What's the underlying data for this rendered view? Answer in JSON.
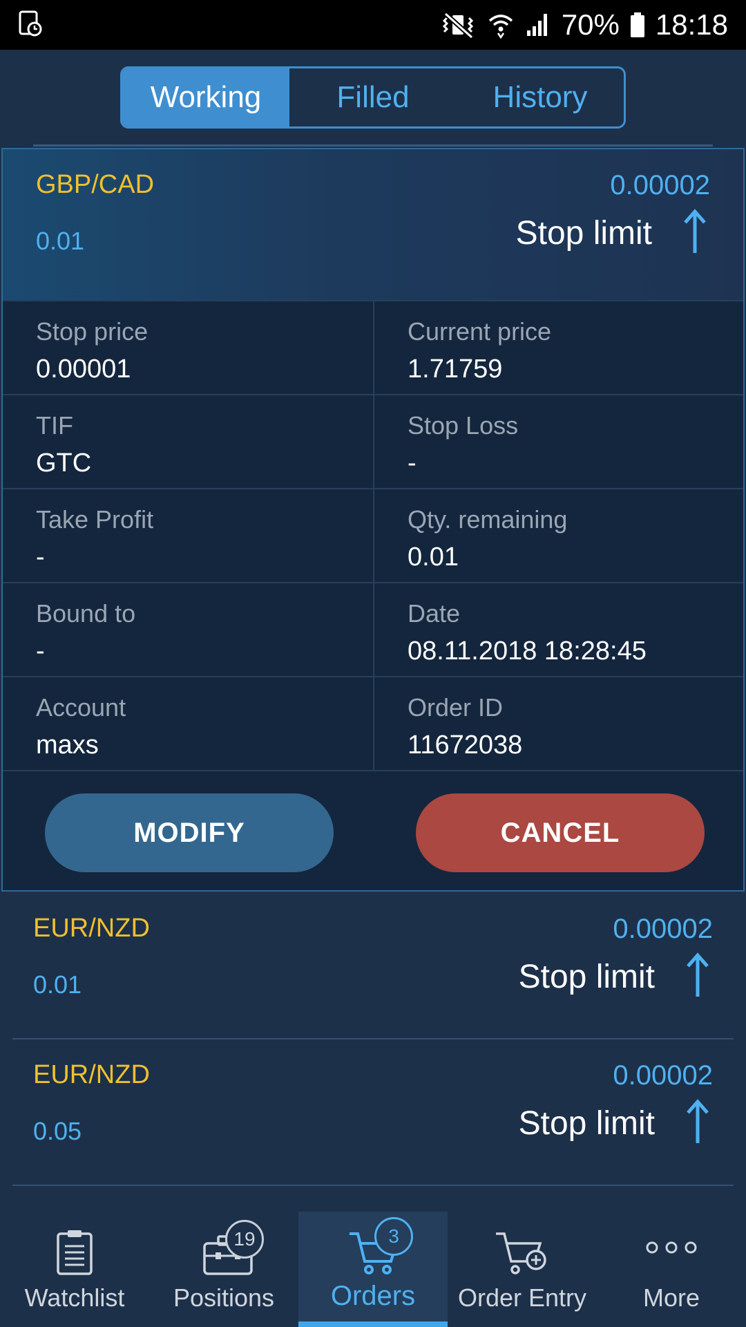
{
  "status_bar": {
    "battery": "70%",
    "time": "18:18",
    "icons": [
      "screenshot-icon",
      "mute-vibrate-icon",
      "wifi-icon",
      "signal-icon",
      "battery-icon"
    ]
  },
  "tabs": [
    {
      "label": "Working",
      "active": true
    },
    {
      "label": "Filled",
      "active": false
    },
    {
      "label": "History",
      "active": false
    }
  ],
  "expanded_order": {
    "symbol": "GBP/CAD",
    "quantity": "0.01",
    "price": "0.00002",
    "order_type": "Stop limit",
    "direction_icon": "arrow-up-icon",
    "fields": [
      {
        "label": "Stop price",
        "value": "0.00001"
      },
      {
        "label": "Current price",
        "value": "1.71759"
      },
      {
        "label": "TIF",
        "value": "GTC"
      },
      {
        "label": "Stop Loss",
        "value": "-"
      },
      {
        "label": "Take Profit",
        "value": "-"
      },
      {
        "label": "Qty. remaining",
        "value": "0.01"
      },
      {
        "label": "Bound to",
        "value": "-"
      },
      {
        "label": "Date",
        "value": "08.11.2018 18:28:45"
      },
      {
        "label": "Account",
        "value": "maxs"
      },
      {
        "label": "Order ID",
        "value": "11672038"
      }
    ],
    "modify_label": "MODIFY",
    "cancel_label": "CANCEL"
  },
  "orders": [
    {
      "symbol": "EUR/NZD",
      "quantity": "0.01",
      "price": "0.00002",
      "order_type": "Stop limit"
    },
    {
      "symbol": "EUR/NZD",
      "quantity": "0.05",
      "price": "0.00002",
      "order_type": "Stop limit"
    }
  ],
  "bottom_nav": [
    {
      "label": "Watchlist",
      "icon": "clipboard-list-icon",
      "badge": null,
      "active": false
    },
    {
      "label": "Positions",
      "icon": "briefcase-icon",
      "badge": "19",
      "active": false
    },
    {
      "label": "Orders",
      "icon": "cart-icon",
      "badge": "3",
      "active": true
    },
    {
      "label": "Order Entry",
      "icon": "cart-plus-icon",
      "badge": null,
      "active": false
    },
    {
      "label": "More",
      "icon": "more-dots-icon",
      "badge": null,
      "active": false
    }
  ],
  "colors": {
    "background": "#1d3049",
    "accent": "#3f8fd0",
    "symbol": "#f0c02e",
    "value_blue": "#4fb1f0",
    "modify": "#336790",
    "cancel": "#aa4841"
  }
}
